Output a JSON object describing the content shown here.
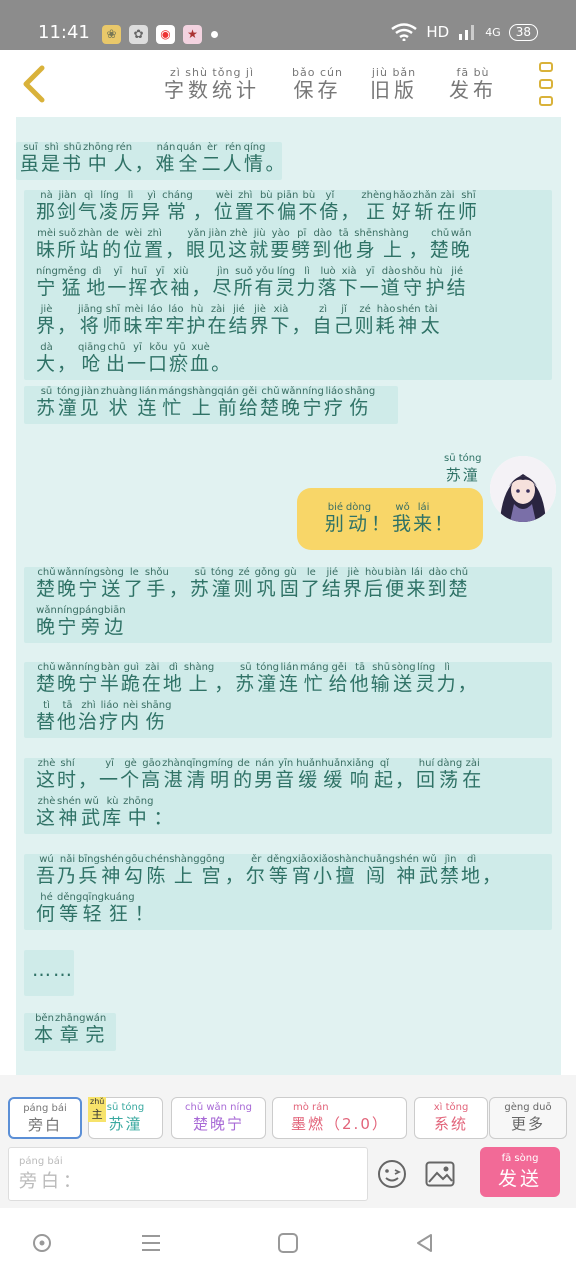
{
  "status_bar": {
    "time": "11:41",
    "network": "HD",
    "signal": "4G",
    "battery": "38"
  },
  "toolbar": {
    "stats": {
      "py": "zì shù tǒng jì",
      "hz": "字数统计"
    },
    "save": {
      "py": "bǎo cún",
      "hz": "保存"
    },
    "old_version": {
      "py": "jiù bǎn",
      "hz": "旧版"
    },
    "publish": {
      "py": "fā bù",
      "hz": "发布"
    }
  },
  "messages": [
    {
      "rows": [
        [
          [
            "虽",
            "suī"
          ],
          [
            "是",
            "shì"
          ],
          [
            "书",
            "shū"
          ],
          [
            "中",
            "zhōng"
          ],
          [
            "人",
            "rén"
          ],
          [
            "，",
            ""
          ],
          [
            "难",
            "nán"
          ],
          [
            "全",
            "quán"
          ],
          [
            "二",
            "èr"
          ],
          [
            "人",
            "rén"
          ],
          [
            "情",
            "qíng"
          ],
          [
            "。",
            ""
          ]
        ]
      ]
    },
    {
      "rows": [
        [
          [
            "那",
            "nà"
          ],
          [
            "剑",
            "jiàn"
          ],
          [
            "气",
            "qì"
          ],
          [
            "凌",
            "líng"
          ],
          [
            "厉",
            "lì"
          ],
          [
            "异",
            "yì"
          ],
          [
            "常",
            "cháng"
          ],
          [
            "，",
            ""
          ],
          [
            "位",
            "wèi"
          ],
          [
            "置",
            "zhì"
          ],
          [
            "不",
            "bù"
          ],
          [
            "偏",
            "piān"
          ],
          [
            "不",
            "bù"
          ],
          [
            "倚",
            "yǐ"
          ],
          [
            "，",
            ""
          ],
          [
            "正",
            "zhèng"
          ],
          [
            "好",
            "hǎo"
          ],
          [
            "斩",
            "zhǎn"
          ],
          [
            "在",
            "zài"
          ],
          [
            "师",
            "shī"
          ]
        ],
        [
          [
            "昧",
            "mèi"
          ],
          [
            "所",
            "suǒ"
          ],
          [
            "站",
            "zhàn"
          ],
          [
            "的",
            "de"
          ],
          [
            "位",
            "wèi"
          ],
          [
            "置",
            "zhì"
          ],
          [
            "，",
            ""
          ],
          [
            "眼",
            "yǎn"
          ],
          [
            "见",
            "jiàn"
          ],
          [
            "这",
            "zhè"
          ],
          [
            "就",
            "jiù"
          ],
          [
            "要",
            "yào"
          ],
          [
            "劈",
            "pī"
          ],
          [
            "到",
            "dào"
          ],
          [
            "他",
            "tā"
          ],
          [
            "身",
            "shēn"
          ],
          [
            "上",
            "shàng"
          ],
          [
            "，",
            ""
          ],
          [
            "楚",
            "chǔ"
          ],
          [
            "晚",
            "wǎn"
          ]
        ],
        [
          [
            "宁",
            "níng"
          ],
          [
            "猛",
            "měng"
          ],
          [
            "地",
            "dì"
          ],
          [
            "一",
            "yī"
          ],
          [
            "挥",
            "huī"
          ],
          [
            "衣",
            "yī"
          ],
          [
            "袖",
            "xiù"
          ],
          [
            "，",
            ""
          ],
          [
            "尽",
            "jìn"
          ],
          [
            "所",
            "suǒ"
          ],
          [
            "有",
            "yǒu"
          ],
          [
            "灵",
            "líng"
          ],
          [
            "力",
            "lì"
          ],
          [
            "落",
            "luò"
          ],
          [
            "下",
            "xià"
          ],
          [
            "一",
            "yī"
          ],
          [
            "道",
            "dào"
          ],
          [
            "守",
            "shǒu"
          ],
          [
            "护",
            "hù"
          ],
          [
            "结",
            "jié"
          ]
        ],
        [
          [
            "界",
            "jiè"
          ],
          [
            "，",
            ""
          ],
          [
            "将",
            "jiāng"
          ],
          [
            "师",
            "shī"
          ],
          [
            "昧",
            "mèi"
          ],
          [
            "牢",
            "láo"
          ],
          [
            "牢",
            "láo"
          ],
          [
            "护",
            "hù"
          ],
          [
            "在",
            "zài"
          ],
          [
            "结",
            "jié"
          ],
          [
            "界",
            "jiè"
          ],
          [
            "下",
            "xià"
          ],
          [
            "，",
            ""
          ],
          [
            "自",
            "zì"
          ],
          [
            "己",
            "jǐ"
          ],
          [
            "则",
            "zé"
          ],
          [
            "耗",
            "hào"
          ],
          [
            "神",
            "shén"
          ],
          [
            "太",
            "tài"
          ]
        ],
        [
          [
            "大",
            "dà"
          ],
          [
            "，",
            ""
          ],
          [
            "呛",
            "qiāng"
          ],
          [
            "出",
            "chū"
          ],
          [
            "一",
            "yī"
          ],
          [
            "口",
            "kǒu"
          ],
          [
            "瘀",
            "yū"
          ],
          [
            "血",
            "xuè"
          ],
          [
            "。",
            ""
          ]
        ]
      ]
    },
    {
      "rows": [
        [
          [
            "苏",
            "sū"
          ],
          [
            "潼",
            "tóng"
          ],
          [
            "见",
            "jiàn"
          ],
          [
            "状",
            "zhuàng"
          ],
          [
            "连",
            "lián"
          ],
          [
            "忙",
            "máng"
          ],
          [
            "上",
            "shàng"
          ],
          [
            "前",
            "qián"
          ],
          [
            "给",
            "gěi"
          ],
          [
            "楚",
            "chǔ"
          ],
          [
            "晚",
            "wǎn"
          ],
          [
            "宁",
            "níng"
          ],
          [
            "疗",
            "liáo"
          ],
          [
            "伤",
            "shāng"
          ]
        ]
      ]
    },
    {
      "rows": [
        [
          [
            "楚",
            "chǔ"
          ],
          [
            "晚",
            "wǎn"
          ],
          [
            "宁",
            "níng"
          ],
          [
            "送",
            "sòng"
          ],
          [
            "了",
            "le"
          ],
          [
            "手",
            "shǒu"
          ],
          [
            "，",
            ""
          ],
          [
            "苏",
            "sū"
          ],
          [
            "潼",
            "tóng"
          ],
          [
            "则",
            "zé"
          ],
          [
            "巩",
            "gǒng"
          ],
          [
            "固",
            "gù"
          ],
          [
            "了",
            "le"
          ],
          [
            "结",
            "jié"
          ],
          [
            "界",
            "jiè"
          ],
          [
            "后",
            "hòu"
          ],
          [
            "便",
            "biàn"
          ],
          [
            "来",
            "lái"
          ],
          [
            "到",
            "dào"
          ],
          [
            "楚",
            "chǔ"
          ]
        ],
        [
          [
            "晚",
            "wǎn"
          ],
          [
            "宁",
            "níng"
          ],
          [
            "旁",
            "páng"
          ],
          [
            "边",
            "biān"
          ]
        ]
      ]
    },
    {
      "rows": [
        [
          [
            "楚",
            "chǔ"
          ],
          [
            "晚",
            "wǎn"
          ],
          [
            "宁",
            "níng"
          ],
          [
            "半",
            "bàn"
          ],
          [
            "跪",
            "guì"
          ],
          [
            "在",
            "zài"
          ],
          [
            "地",
            "dì"
          ],
          [
            "上",
            "shàng"
          ],
          [
            "，",
            ""
          ],
          [
            "苏",
            "sū"
          ],
          [
            "潼",
            "tóng"
          ],
          [
            "连",
            "lián"
          ],
          [
            "忙",
            "máng"
          ],
          [
            "给",
            "gěi"
          ],
          [
            "他",
            "tā"
          ],
          [
            "输",
            "shū"
          ],
          [
            "送",
            "sòng"
          ],
          [
            "灵",
            "líng"
          ],
          [
            "力",
            "lì"
          ],
          [
            "，",
            ""
          ]
        ],
        [
          [
            "替",
            "tì"
          ],
          [
            "他",
            "tā"
          ],
          [
            "治",
            "zhì"
          ],
          [
            "疗",
            "liáo"
          ],
          [
            "内",
            "nèi"
          ],
          [
            "伤",
            "shāng"
          ]
        ]
      ]
    },
    {
      "rows": [
        [
          [
            "这",
            "zhè"
          ],
          [
            "时",
            "shí"
          ],
          [
            "，",
            ""
          ],
          [
            "一",
            "yī"
          ],
          [
            "个",
            "gè"
          ],
          [
            "高",
            "gāo"
          ],
          [
            "湛",
            "zhàn"
          ],
          [
            "清",
            "qīng"
          ],
          [
            "明",
            "míng"
          ],
          [
            "的",
            "de"
          ],
          [
            "男",
            "nán"
          ],
          [
            "音",
            "yīn"
          ],
          [
            "缓",
            "huǎn"
          ],
          [
            "缓",
            "huǎn"
          ],
          [
            "响",
            "xiǎng"
          ],
          [
            "起",
            "qǐ"
          ],
          [
            "，",
            ""
          ],
          [
            "回",
            "huí"
          ],
          [
            "荡",
            "dàng"
          ],
          [
            "在",
            "zài"
          ]
        ],
        [
          [
            "这",
            "zhè"
          ],
          [
            "神",
            "shén"
          ],
          [
            "武",
            "wǔ"
          ],
          [
            "库",
            "kù"
          ],
          [
            "中",
            "zhōng"
          ],
          [
            "：",
            ""
          ]
        ]
      ]
    },
    {
      "rows": [
        [
          [
            "吾",
            "wú"
          ],
          [
            "乃",
            "nǎi"
          ],
          [
            "兵",
            "bīng"
          ],
          [
            "神",
            "shén"
          ],
          [
            "勾",
            "gōu"
          ],
          [
            "陈",
            "chén"
          ],
          [
            "上",
            "shàng"
          ],
          [
            "宫",
            "gōng"
          ],
          [
            "，",
            ""
          ],
          [
            "尔",
            "ěr"
          ],
          [
            "等",
            "děng"
          ],
          [
            "宵",
            "xiāo"
          ],
          [
            "小",
            "xiǎo"
          ],
          [
            "擅",
            "shàn"
          ],
          [
            "闯",
            "chuǎng"
          ],
          [
            "神",
            "shén"
          ],
          [
            "武",
            "wǔ"
          ],
          [
            "禁",
            "jìn"
          ],
          [
            "地",
            "dì"
          ],
          [
            "，",
            ""
          ]
        ],
        [
          [
            "何",
            "hé"
          ],
          [
            "等",
            "děng"
          ],
          [
            "轻",
            "qīng"
          ],
          [
            "狂",
            "kuáng"
          ],
          [
            "！",
            ""
          ]
        ]
      ]
    },
    {
      "plain": "……"
    },
    {
      "rows": [
        [
          [
            "本",
            "běn"
          ],
          [
            "章",
            "zhāng"
          ],
          [
            "完",
            "wán"
          ]
        ]
      ]
    }
  ],
  "user_message": {
    "speaker": {
      "py": "sū tóng",
      "hz": "苏潼"
    },
    "rows": [
      [
        [
          "别",
          "bié"
        ],
        [
          "动",
          "dòng"
        ],
        [
          "！",
          ""
        ],
        [
          "我",
          "wǒ"
        ],
        [
          "来",
          "lái"
        ],
        [
          "！",
          ""
        ]
      ]
    ]
  },
  "roles": {
    "narrator": {
      "py": "páng bái",
      "hz": "旁白"
    },
    "sutong": {
      "py": "sū tóng",
      "hz": "苏潼",
      "badge": "主",
      "badge_py": "zhǔ"
    },
    "chuwanning": {
      "py": "chǔ wǎn níng",
      "hz": "楚晚宁"
    },
    "moran": {
      "py": "mò rán",
      "hz": "墨燃",
      "suffix": "（2.0）"
    },
    "system": {
      "py": "xì tǒng",
      "hz": "系统"
    },
    "more": {
      "py": "gèng duō",
      "hz": "更多"
    }
  },
  "input": {
    "py": "páng bái",
    "hz": "旁白："
  },
  "send": {
    "py": "fā sòng",
    "hz": "发送"
  },
  "colors": {
    "accent": "#f26a97",
    "bubble": "#cfebe9",
    "user_bubble": "#f8d668",
    "text": "#2f7266"
  }
}
